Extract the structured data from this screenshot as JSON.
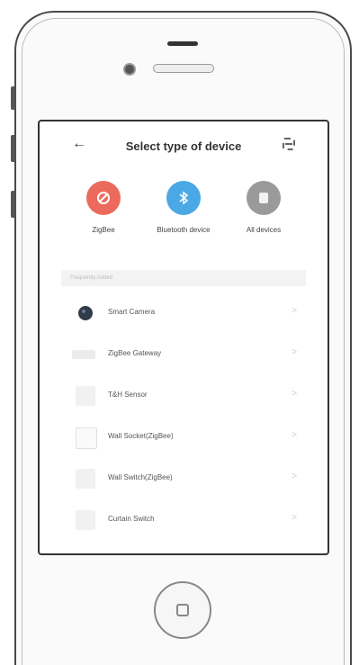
{
  "header": {
    "back_icon": "←",
    "title": "Select type of device",
    "scan_icon": "scan-icon"
  },
  "categories": [
    {
      "label": "ZigBee",
      "icon": "zigbee-icon",
      "color": "#ec6a5c"
    },
    {
      "label": "Bluetooth device",
      "icon": "bluetooth-icon",
      "color": "#4aa8e4"
    },
    {
      "label": "All devices",
      "icon": "all-devices-icon",
      "color": "#9a9a9a"
    }
  ],
  "section": {
    "title": "Frequently Added"
  },
  "devices": [
    {
      "label": "Smart Camera",
      "chevron": ">"
    },
    {
      "label": "ZigBee Gateway",
      "chevron": ">"
    },
    {
      "label": "T&H Sensor",
      "chevron": ">"
    },
    {
      "label": "Wall Socket(ZigBee)",
      "chevron": ">"
    },
    {
      "label": "Wall Switch(ZigBee)",
      "chevron": ">"
    },
    {
      "label": "Curtain Switch",
      "chevron": ">"
    }
  ]
}
